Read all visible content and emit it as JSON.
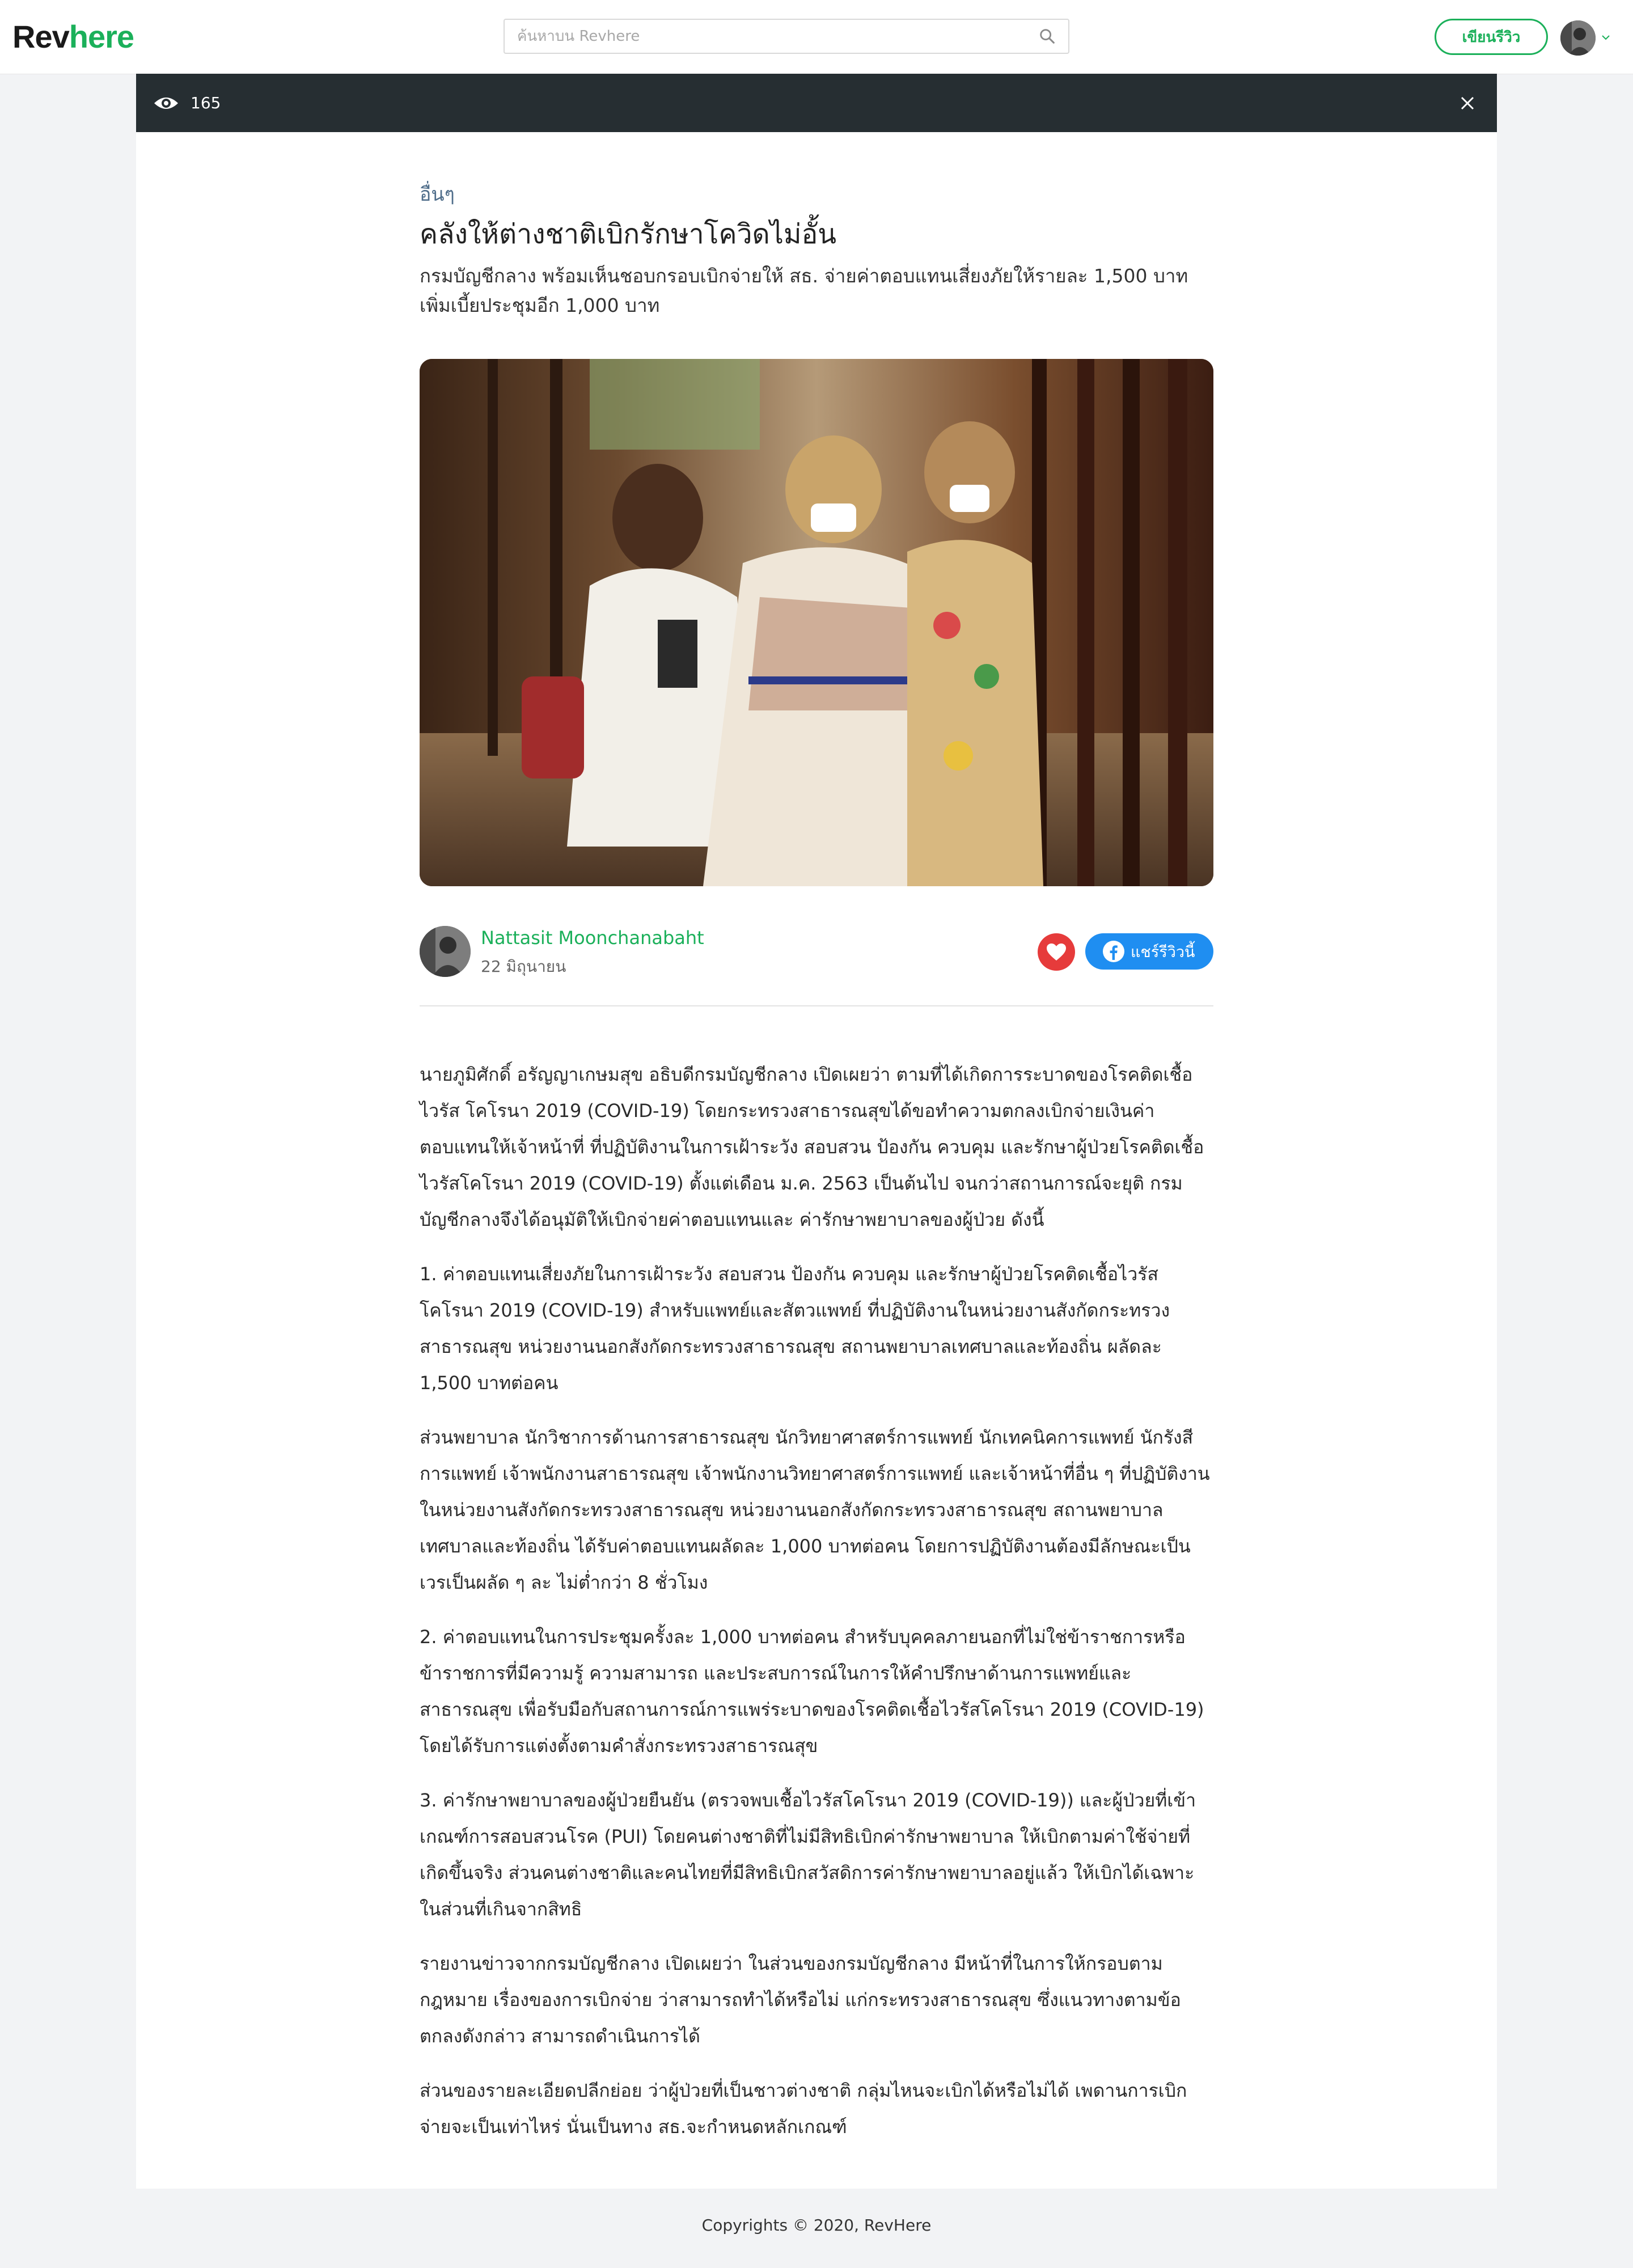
{
  "header": {
    "logo_part1": "Rev",
    "logo_part2": "here",
    "search_placeholder": "ค้นหาบน Revhere",
    "write_review_label": "เขียนรีวิว",
    "icons": [
      "search-icon",
      "avatar",
      "chevron-down-icon"
    ]
  },
  "viewbar": {
    "view_count": "165",
    "icons": [
      "eye-icon",
      "close-icon"
    ]
  },
  "article": {
    "category": "อื่นๆ",
    "title": "คลังให้ต่างชาติเบิกรักษาโควิดไม่อั้น",
    "subtitle": "กรมบัญชีกลาง พร้อมเห็นชอบกรอบเบิกจ่ายให้ สธ. จ่ายค่าตอบแทนเสี่ยงภัยให้รายละ 1,500 บาท เพิ่มเบี้ยประชุมอีก 1,000 บาท",
    "author": {
      "name": "Nattasit Moonchanabaht",
      "date": "22 มิถุนายน"
    },
    "share_label": "แชร์รีวิวนี้",
    "paragraphs": [
      "นายภูมิศักดิ์ อรัญญาเกษมสุข อธิบดีกรมบัญชีกลาง เปิดเผยว่า ตามที่ได้เกิดการระบาดของโรคติดเชื้อไวรัส   โคโรนา 2019 (COVID-19) โดยกระทรวงสาธารณสุขได้ขอทำความตกลงเบิกจ่ายเงินค่าตอบแทนให้เจ้าหน้าที่ ที่ปฏิบัติงานในการเฝ้าระวัง สอบสวน ป้องกัน ควบคุม และรักษาผู้ป่วยโรคติดเชื้อไวรัสโคโรนา 2019 (COVID-19) ตั้งแต่เดือน ม.ค. 2563 เป็นต้นไป จนกว่าสถานการณ์จะยุติ กรมบัญชีกลางจึงได้อนุมัติให้เบิกจ่ายค่าตอบแทนและ ค่ารักษาพยาบาลของผู้ป่วย ดังนี้",
      "1. ค่าตอบแทนเสี่ยงภัยในการเฝ้าระวัง สอบสวน ป้องกัน ควบคุม และรักษาผู้ป่วยโรคติดเชื้อไวรัสโคโรนา 2019 (COVID-19) สำหรับแพทย์และสัตวแพทย์ ที่ปฏิบัติงานในหน่วยงานสังกัดกระทรวงสาธารณสุข  หน่วยงานนอกสังกัดกระทรวงสาธารณสุข สถานพยาบาลเทศบาลและท้องถิ่น ผลัดละ 1,500 บาทต่อคน",
      "ส่วนพยาบาล นักวิชาการด้านการสาธารณสุข นักวิทยาศาสตร์การแพทย์ นักเทคนิคการแพทย์ นักรังสีการแพทย์ เจ้าพนักงานสาธารณสุข เจ้าพนักงานวิทยาศาสตร์การแพทย์ และเจ้าหน้าที่อื่น ๆ ที่ปฏิบัติงานในหน่วยงานสังกัดกระทรวงสาธารณสุข หน่วยงานนอกสังกัดกระทรวงสาธารณสุข สถานพยาบาล เทศบาลและท้องถิ่น ได้รับค่าตอบแทนผลัดละ 1,000 บาทต่อคน โดยการปฏิบัติงานต้องมีลักษณะเป็นเวรเป็นผลัด ๆ ละ ไม่ต่ำกว่า 8 ชั่วโมง",
      "2. ค่าตอบแทนในการประชุมครั้งละ 1,000 บาทต่อคน สำหรับบุคคลภายนอกที่ไม่ใช่ข้าราชการหรือข้าราชการที่มีความรู้ ความสามารถ และประสบการณ์ในการให้คำปรึกษาด้านการแพทย์และสาธารณสุข เพื่อรับมือกับสถานการณ์การแพร่ระบาดของโรคติดเชื้อไวรัสโคโรนา 2019 (COVID-19) โดยได้รับการแต่งตั้งตามคำสั่งกระทรวงสาธารณสุข",
      "3. ค่ารักษาพยาบาลของผู้ป่วยยืนยัน (ตรวจพบเชื้อไวรัสโคโรนา 2019 (COVID-19)) และผู้ป่วยที่เข้าเกณฑ์การสอบสวนโรค (PUI) โดยคนต่างชาติที่ไม่มีสิทธิเบิกค่ารักษาพยาบาล ให้เบิกตามค่าใช้จ่ายที่เกิดขึ้นจริง ส่วนคนต่างชาติและคนไทยที่มีสิทธิเบิกสวัสดิการค่ารักษาพยาบาลอยู่แล้ว ให้เบิกได้เฉพาะในส่วนที่เกินจากสิทธิ",
      "รายงานข่าวจากกรมบัญชีกลาง เปิดเผยว่า ในส่วนของกรมบัญชีกลาง มีหน้าที่ในการให้กรอบตามกฎหมาย เรื่องของการเบิกจ่าย ว่าสามารถทำได้หรือไม่ แก่กระทรวงสาธารณสุข ซึ่งแนวทางตามข้อตกลงดังกล่าว สามารถดำเนินการได้",
      "ส่วนของรายละเอียดปลีกย่อย ว่าผู้ป่วยที่เป็นชาวต่างชาติ กลุ่มไหนจะเบิกได้หรือไม่ได้ เพดานการเบิกจ่ายจะเป็นเท่าไหร่ นั่นเป็นทาง สธ.จะกำหนดหลักเกณฑ์"
    ]
  },
  "footer": {
    "copyright": "Copyrights © 2020, RevHere"
  },
  "colors": {
    "brand_green": "#1bb05a",
    "dark_bar": "#262e32",
    "like_red": "#e63b3b",
    "facebook_blue": "#1f8ef1",
    "category_blue": "#4f6d8a"
  }
}
